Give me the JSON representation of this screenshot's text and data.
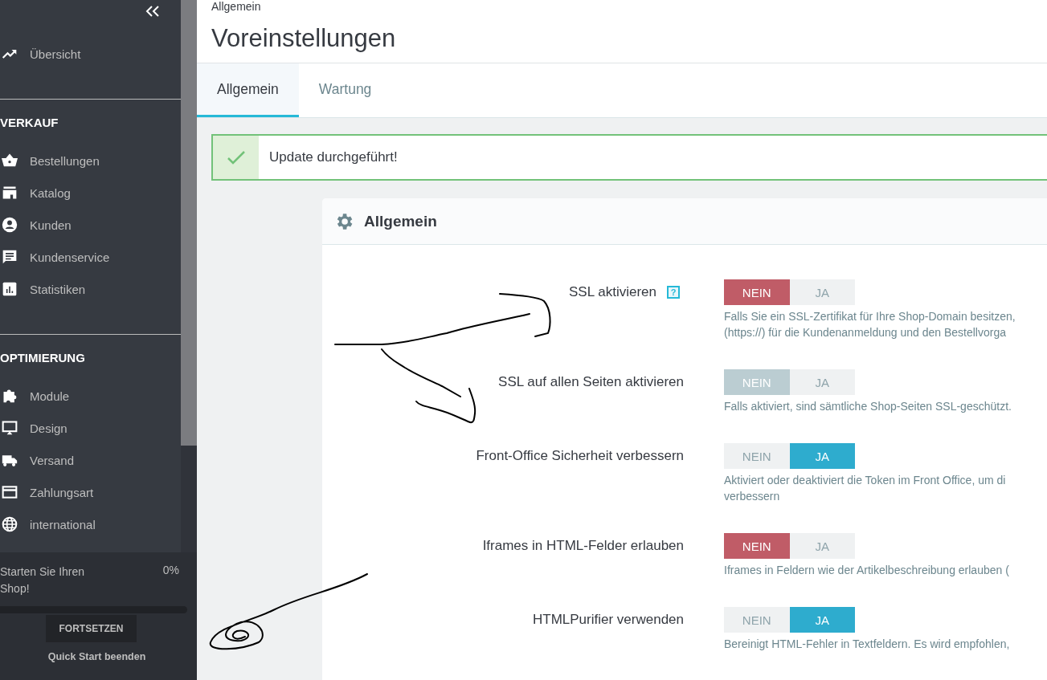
{
  "sidebar": {
    "top": [
      {
        "label": "Übersicht"
      }
    ],
    "sections": [
      {
        "title": "VERKAUF",
        "items": [
          {
            "label": "Bestellungen"
          },
          {
            "label": "Katalog"
          },
          {
            "label": "Kunden"
          },
          {
            "label": "Kundenservice"
          },
          {
            "label": "Statistiken"
          }
        ]
      },
      {
        "title": "OPTIMIERUNG",
        "items": [
          {
            "label": "Module"
          },
          {
            "label": "Design"
          },
          {
            "label": "Versand"
          },
          {
            "label": "Zahlungsart"
          },
          {
            "label": "international"
          }
        ]
      }
    ],
    "quick_start": {
      "text": "Starten Sie Ihren Shop!",
      "percent": "0%",
      "level": 0,
      "button": "FORTSETZEN",
      "link": "Quick Start beenden"
    }
  },
  "header": {
    "breadcrumb": "Allgemein",
    "title": "Voreinstellungen"
  },
  "tabs": [
    {
      "label": "Allgemein",
      "selected": true
    },
    {
      "label": "Wartung",
      "selected": false
    }
  ],
  "alert": {
    "message": "Update durchgeführt!"
  },
  "panel": {
    "title": "Allgemein",
    "fields": [
      {
        "label": "SSL aktivieren",
        "hint": "?",
        "disabled": false,
        "options": [
          {
            "label": "NEIN",
            "selected": true
          },
          {
            "label": "JA",
            "selected": false
          }
        ],
        "help": [
          "Falls Sie ein SSL-Zertifikat für Ihre Shop-Domain besitzen,",
          "(https://) für die Kundenanmeldung und den Bestellvorga"
        ]
      },
      {
        "label": "SSL auf allen Seiten aktivieren",
        "disabled": true,
        "options": [
          {
            "label": "NEIN",
            "selected": true
          },
          {
            "label": "JA",
            "selected": false
          }
        ],
        "help": [
          "Falls aktiviert, sind sämtliche Shop-Seiten SSL-geschützt."
        ]
      },
      {
        "label": "Front-Office Sicherheit verbessern",
        "disabled": false,
        "options": [
          {
            "label": "NEIN",
            "selected": false
          },
          {
            "label": "JA",
            "selected": true
          }
        ],
        "help": [
          "Aktiviert oder deaktiviert die Token im Front Office, um di",
          "verbessern"
        ]
      },
      {
        "label": "Iframes in HTML-Felder erlauben",
        "disabled": false,
        "options": [
          {
            "label": "NEIN",
            "selected": true
          },
          {
            "label": "JA",
            "selected": false
          }
        ],
        "help": [
          "Iframes in Feldern wie der Artikelbeschreibung erlauben ("
        ]
      },
      {
        "label": "HTMLPurifier verwenden",
        "disabled": false,
        "options": [
          {
            "label": "NEIN",
            "selected": false
          },
          {
            "label": "JA",
            "selected": true
          }
        ],
        "help": [
          "Bereinigt HTML-Fehler in Textfeldern. Es wird empfohlen,"
        ]
      }
    ]
  }
}
